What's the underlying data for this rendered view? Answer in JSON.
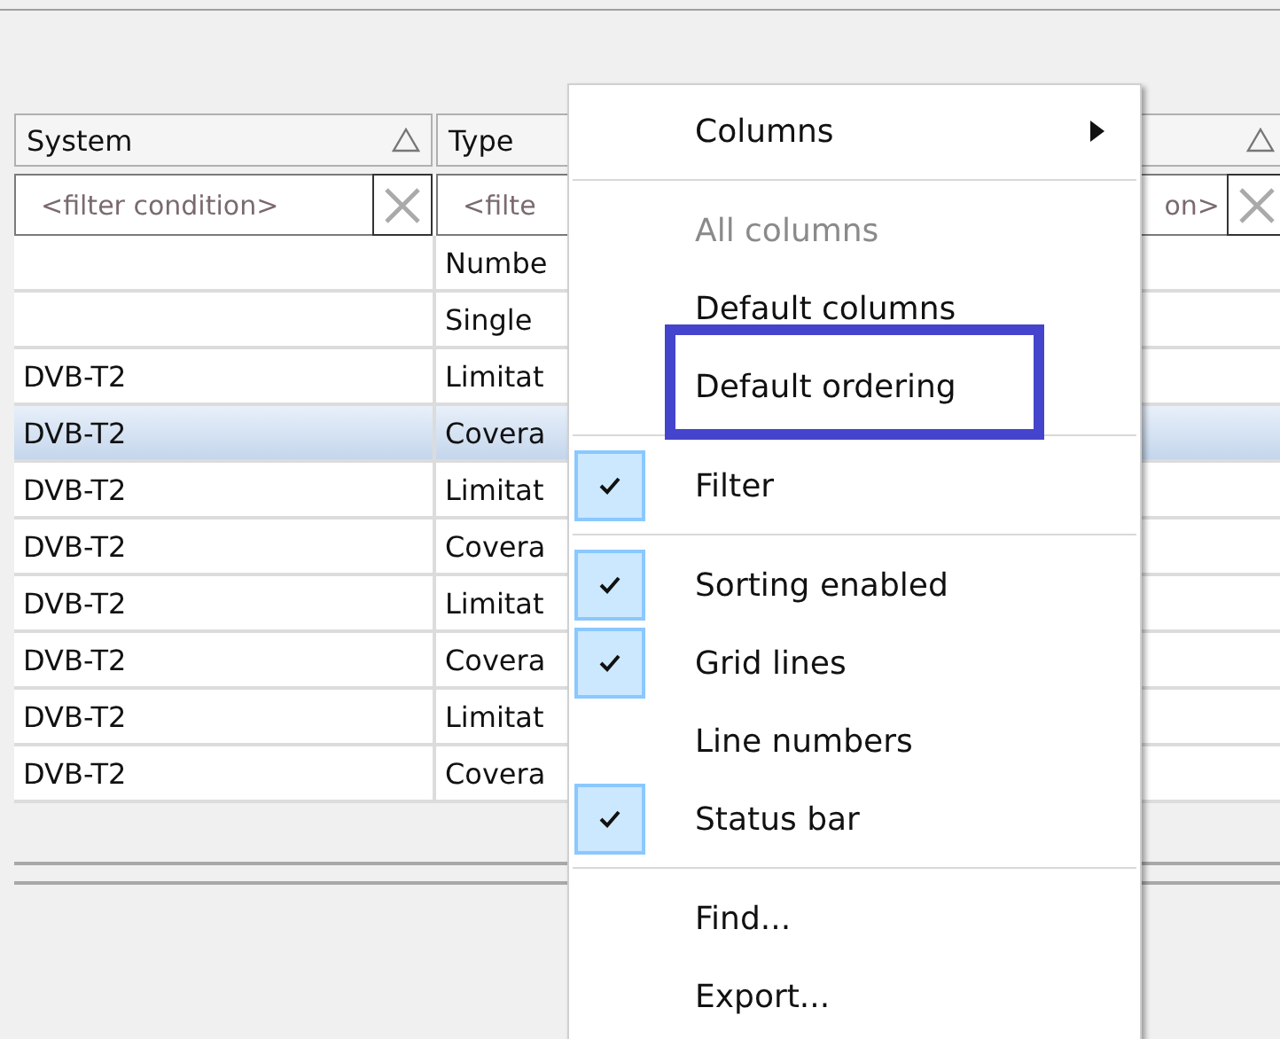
{
  "table": {
    "columns": [
      {
        "label": "System",
        "sort_icon": true
      },
      {
        "label": "Type",
        "sort_icon": false
      },
      {
        "sort_icon": true
      }
    ],
    "filters": [
      {
        "placeholder": "<filter condition>"
      },
      {
        "placeholder": "<filte"
      },
      {
        "placeholder": "on>"
      }
    ],
    "rows": [
      {
        "cells": [
          "",
          "Numbe",
          ""
        ],
        "selected": false
      },
      {
        "cells": [
          "",
          "Single",
          ""
        ],
        "selected": false
      },
      {
        "cells": [
          "DVB-T2",
          "Limitat",
          ""
        ],
        "selected": false
      },
      {
        "cells": [
          "DVB-T2",
          "Covera",
          ""
        ],
        "selected": true
      },
      {
        "cells": [
          "DVB-T2",
          "Limitat",
          ""
        ],
        "selected": false
      },
      {
        "cells": [
          "DVB-T2",
          "Covera",
          ""
        ],
        "selected": false
      },
      {
        "cells": [
          "DVB-T2",
          "Limitat",
          ""
        ],
        "selected": false
      },
      {
        "cells": [
          "DVB-T2",
          "Covera",
          ""
        ],
        "selected": false
      },
      {
        "cells": [
          "DVB-T2",
          "Limitat",
          ""
        ],
        "selected": false
      },
      {
        "cells": [
          "DVB-T2",
          "Covera",
          ""
        ],
        "selected": false
      }
    ]
  },
  "context_menu": {
    "items": [
      {
        "kind": "submenu",
        "label": "Columns",
        "disabled": false,
        "highlighted": false
      },
      {
        "kind": "separator"
      },
      {
        "kind": "action",
        "label": "All columns",
        "disabled": true,
        "highlighted": false
      },
      {
        "kind": "action",
        "label": "Default columns",
        "disabled": false,
        "highlighted": false
      },
      {
        "kind": "action",
        "label": "Default ordering",
        "disabled": false,
        "highlighted": true
      },
      {
        "kind": "separator"
      },
      {
        "kind": "check",
        "label": "Filter",
        "checked": true,
        "disabled": false,
        "highlighted": false
      },
      {
        "kind": "separator"
      },
      {
        "kind": "check",
        "label": "Sorting enabled",
        "checked": true,
        "disabled": false,
        "highlighted": false
      },
      {
        "kind": "check",
        "label": "Grid lines",
        "checked": true,
        "disabled": false,
        "highlighted": false
      },
      {
        "kind": "check",
        "label": "Line numbers",
        "checked": false,
        "disabled": false,
        "highlighted": false
      },
      {
        "kind": "check",
        "label": "Status bar",
        "checked": true,
        "disabled": false,
        "highlighted": false
      },
      {
        "kind": "separator"
      },
      {
        "kind": "action",
        "label": "Find...",
        "disabled": false,
        "highlighted": false
      },
      {
        "kind": "action",
        "label": "Export...",
        "disabled": false,
        "highlighted": false
      }
    ]
  }
}
